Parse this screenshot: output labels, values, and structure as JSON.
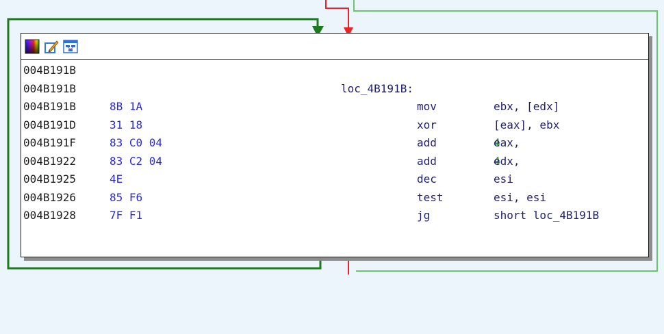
{
  "toolbar": {
    "icons": [
      "color-palette-icon",
      "edit-node-icon",
      "graph-layout-icon"
    ]
  },
  "colors": {
    "background": "#ecf5fb",
    "edge_true": "#1b7a1b",
    "edge_false": "#ee2222",
    "edge_loop": "#6cc46c",
    "address": "#1c1c1c",
    "bytes": "#2a2adb",
    "instruction": "#1e1e6e",
    "immediate": "#1b8a1b"
  },
  "lines": [
    {
      "addr": "004B191B",
      "bytes": "",
      "label": "",
      "mnem": "",
      "op": "",
      "imm": ""
    },
    {
      "addr": "004B191B",
      "bytes": "",
      "label": "loc_4B191B:",
      "mnem": "",
      "op": "",
      "imm": ""
    },
    {
      "addr": "004B191B",
      "bytes": "8B 1A",
      "label": "",
      "mnem": "mov",
      "op": "ebx, [edx]",
      "imm": ""
    },
    {
      "addr": "004B191D",
      "bytes": "31 18",
      "label": "",
      "mnem": "xor",
      "op": "[eax], ebx",
      "imm": ""
    },
    {
      "addr": "004B191F",
      "bytes": "83 C0 04",
      "label": "",
      "mnem": "add",
      "op": "eax, ",
      "imm": "4"
    },
    {
      "addr": "004B1922",
      "bytes": "83 C2 04",
      "label": "",
      "mnem": "add",
      "op": "edx, ",
      "imm": "4"
    },
    {
      "addr": "004B1925",
      "bytes": "4E",
      "label": "",
      "mnem": "dec",
      "op": "esi",
      "imm": ""
    },
    {
      "addr": "004B1926",
      "bytes": "85 F6",
      "label": "",
      "mnem": "test",
      "op": "esi, esi",
      "imm": ""
    },
    {
      "addr": "004B1928",
      "bytes": "7F F1",
      "label": "",
      "mnem": "jg",
      "op": "short loc_4B191B",
      "imm": ""
    }
  ]
}
